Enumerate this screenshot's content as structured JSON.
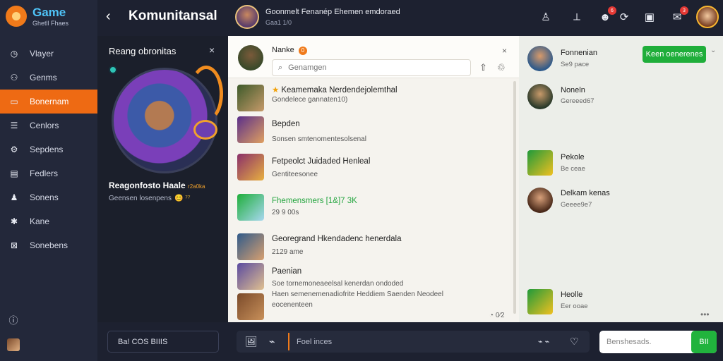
{
  "app": {
    "logo_title": "Game",
    "logo_sub": "Ghetll Fhaes",
    "accent": "#ee6a13"
  },
  "nav": {
    "items": [
      {
        "label": "Vlayer",
        "icon": "clock-icon",
        "glyph": "◷",
        "active": false
      },
      {
        "label": "Genms",
        "icon": "people-icon",
        "glyph": "⚇",
        "active": false
      },
      {
        "label": "Bonernam",
        "icon": "chat-icon",
        "glyph": "▭",
        "active": true
      },
      {
        "label": "Cenlors",
        "icon": "list-icon",
        "glyph": "☰",
        "active": false
      },
      {
        "label": "Sepdens",
        "icon": "settings-icon",
        "glyph": "⚙",
        "active": false
      },
      {
        "label": "Fedlers",
        "icon": "folder-icon",
        "glyph": "▤",
        "active": false
      },
      {
        "label": "Sonens",
        "icon": "person-icon",
        "glyph": "♟",
        "active": false
      },
      {
        "label": "Kane",
        "icon": "puzzle-icon",
        "glyph": "✱",
        "active": false
      },
      {
        "label": "Sonebens",
        "icon": "box-icon",
        "glyph": "⊠",
        "active": false
      }
    ],
    "help_glyph": "ⓘ"
  },
  "topbar": {
    "back_glyph": "‹",
    "title": "Komunitansal",
    "user_name": "Goonmelt Fenanép  Ehemen emdoraed",
    "user_sub": "Gaa1 1/0",
    "icons": [
      {
        "name": "profile-icon",
        "glyph": "♙",
        "badge": ""
      },
      {
        "name": "pin-icon",
        "glyph": "⟂",
        "badge": ""
      },
      {
        "name": "emoji-icon",
        "glyph": "☻",
        "badge": "6"
      },
      {
        "name": "refresh-icon",
        "glyph": "⟳",
        "badge": ""
      },
      {
        "name": "square-icon",
        "glyph": "▣",
        "badge": ""
      },
      {
        "name": "message-icon",
        "glyph": "✉",
        "badge": "3"
      }
    ]
  },
  "profile": {
    "title": "Reang obronitas",
    "close_glyph": "×",
    "name": "Reagonfosto Haale",
    "name_suffix": "r2a0ka",
    "desc": "Geensen losenpens",
    "emoji": "😊 ⁷⁷"
  },
  "chatlist": {
    "title": "Nanke",
    "badge": "0",
    "close_glyph": "×",
    "search_placeholder": "Genamgen",
    "search_glyph": "⌕",
    "action_glyphs": [
      "⇧",
      "♲"
    ],
    "rows": [
      {
        "title": "Keamemaka Nerdendejolemthal",
        "star": true,
        "subs": [
          "Gondelece gannaten10)"
        ],
        "color": "default"
      },
      {
        "title": "Bepden",
        "star": false,
        "subs": [
          "Sonsen smtenomentesolsenal"
        ],
        "color": "default"
      },
      {
        "title": "Fetpeolct Juidaded Henleal",
        "star": false,
        "subs": [
          "Gentiteesonee"
        ],
        "color": "default"
      },
      {
        "title": "Fhemensmers [1&]7 3K",
        "star": false,
        "subs": [
          "29 9 00s"
        ],
        "color": "green"
      },
      {
        "title": "Georegrand Hkendadenc henerdala",
        "star": false,
        "subs": [
          "2129 ame"
        ],
        "color": "default"
      },
      {
        "title": "Paenian",
        "star": false,
        "subs": [
          "Soe tornemoneaeelsal kenerdan ondoded",
          "Haen semenemenadiofrite Heddiem Saenden Neodeel",
          "eocenenteen"
        ],
        "color": "default"
      },
      {
        "title": "",
        "star": false,
        "subs": [],
        "color": "default"
      }
    ],
    "footer": "◔ 0⁄2"
  },
  "right": {
    "join_label": "Keen oenerenes",
    "chev": "⌄",
    "more": "•••",
    "items": [
      {
        "title": "Fonnenian",
        "sub": "Se9 pace"
      },
      {
        "title": "Noneln",
        "sub": "Gereeed67"
      },
      {
        "title": "Pekole",
        "sub": "Be ceae"
      },
      {
        "title": "Delkam kenas",
        "sub": "Geeee9e7"
      },
      {
        "title": "Heolle",
        "sub": "Eer ooae"
      }
    ]
  },
  "bottombar": {
    "left_label": "Ba! COS BIIIS",
    "input_placeholder": "Foel inces",
    "icons": [
      "🖼",
      "⌁"
    ],
    "trail_glyphs": [
      "⌁ ⌁",
      "♡"
    ],
    "right_placeholder": "Benshesads.",
    "send_label": "BII"
  }
}
